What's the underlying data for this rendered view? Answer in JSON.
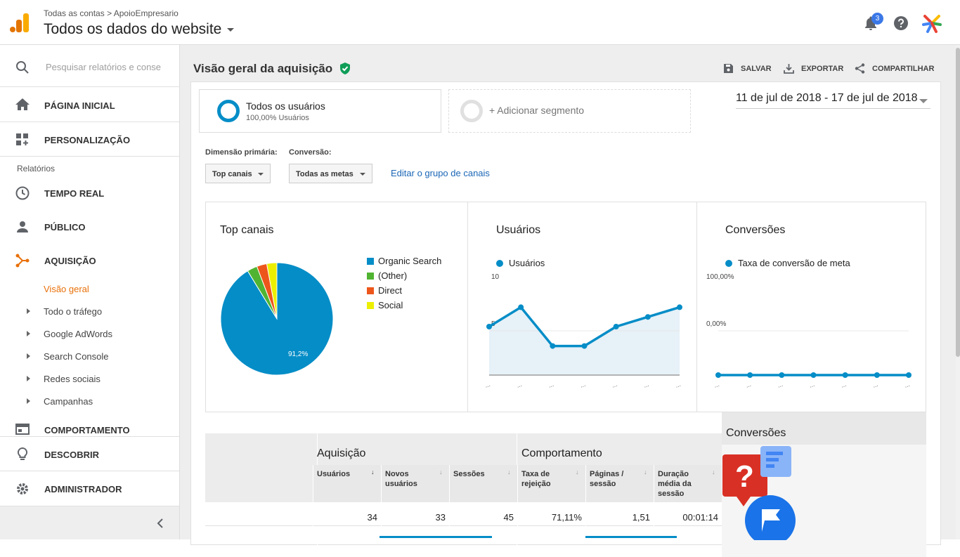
{
  "header": {
    "breadcrumb_root": "Todas as contas",
    "breadcrumb_account": "ApoioEmpresario",
    "view_name": "Todos os dados do website",
    "notification_count": "3"
  },
  "sidebar": {
    "search_placeholder": "Pesquisar relatórios e conse",
    "home": "PÁGINA INICIAL",
    "custom": "PERSONALIZAÇÃO",
    "reports_label": "Relatórios",
    "realtime": "TEMPO REAL",
    "audience": "PÚBLICO",
    "acquisition": "AQUISIÇÃO",
    "acq_sub": [
      "Visão geral",
      "Todo o tráfego",
      "Google AdWords",
      "Search Console",
      "Redes sociais",
      "Campanhas"
    ],
    "behavior": "COMPORTAMENTO",
    "discover": "DESCOBRIR",
    "admin": "ADMINISTRADOR"
  },
  "page": {
    "title": "Visão geral da aquisição",
    "save": "SALVAR",
    "export": "EXPORTAR",
    "share": "COMPARTILHAR"
  },
  "segments": {
    "seg1_title": "Todos os usuários",
    "seg1_sub": "100,00% Usuários",
    "add_segment": "+ Adicionar segmento"
  },
  "date_range": "11 de jul de 2018 - 17 de jul de 2018",
  "filters": {
    "primary_dim_label": "Dimensão primária:",
    "primary_dim_value": "Top canais",
    "conversion_label": "Conversão:",
    "conversion_value": "Todas as metas",
    "edit_link": "Editar o grupo de canais"
  },
  "chart_data": [
    {
      "type": "pie",
      "title": "Top canais",
      "categories": [
        "Organic Search",
        "(Other)",
        "Direct",
        "Social"
      ],
      "values": [
        91.2,
        2.9,
        2.9,
        2.9
      ],
      "slice_label": "91,2%",
      "colors": [
        "#058dc7",
        "#50b432",
        "#ed561b",
        "#edef00"
      ]
    },
    {
      "type": "area",
      "title": "Usuários",
      "series": [
        {
          "name": "Usuários",
          "values": [
            5,
            7,
            3,
            3,
            5,
            6,
            7
          ]
        }
      ],
      "yticks": [
        "10",
        "5"
      ],
      "ylim": [
        0,
        10
      ],
      "xlabel_char": "..."
    },
    {
      "type": "line",
      "title": "Conversões",
      "series": [
        {
          "name": "Taxa de conversão de meta",
          "values": [
            0,
            0,
            0,
            0,
            0,
            0,
            0
          ]
        }
      ],
      "yticks": [
        "100,00%",
        "0,00%"
      ],
      "ylim": [
        0,
        100
      ],
      "xlabel_char": "..."
    }
  ],
  "table": {
    "group_acq": "Aquisição",
    "group_beh": "Comportamento",
    "group_conv": "Conversões",
    "columns": [
      "Usuários",
      "Novos usuários",
      "Sessões",
      "Taxa de rejeição",
      "Páginas / sessão",
      "Duração média da sessão"
    ],
    "totals": [
      "34",
      "33",
      "45",
      "71,11%",
      "1,51",
      "00:01:14"
    ]
  },
  "colors": {
    "accent": "#e8710a",
    "link": "#1a66b6",
    "chart": "#058dc7"
  }
}
